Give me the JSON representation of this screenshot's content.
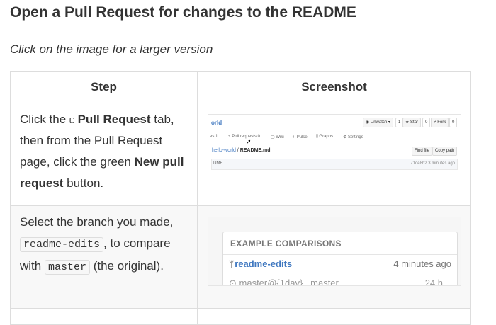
{
  "heading": "Open a Pull Request for changes to the README",
  "subtitle": "Click on the image for a larger version",
  "table": {
    "headers": [
      "Step",
      "Screenshot"
    ],
    "row1": {
      "text_a": "Click the ",
      "icon": "ᥴ",
      "bold_a": "Pull Request",
      "text_b": " tab, then from the Pull Request page, click the green ",
      "bold_b": "New pull request",
      "text_c": " button."
    },
    "row2": {
      "text_a": "Select the branch you made, ",
      "code_a": "readme-edits",
      "text_b": ", to compare with ",
      "code_b": "master",
      "text_c": " (the original)."
    }
  },
  "shot1": {
    "repo": "orld",
    "unwatch": "◉ Unwatch ▾",
    "unwatch_count": "1",
    "star": "★ Star",
    "star_count": "0",
    "fork": "⑂ Fork",
    "fork_count": "0",
    "nav": [
      "es  1",
      "⑂ Pull requests  0",
      "▢ Wiki",
      "∻ Pulse",
      "⫼ Graphs",
      "⚙ Settings"
    ],
    "crumb_link": "hello-world",
    "crumb_sep": " / ",
    "crumb_file": "README.md",
    "find_file": "Find file",
    "copy_path": "Copy path",
    "file_left": "DME",
    "file_right": "71de8b2  3 minutes ago"
  },
  "shot2": {
    "header": "EXAMPLE COMPARISONS",
    "branch": "readme-edits",
    "time": "4 minutes ago",
    "faded_left": "⊙ master@{1day}...master",
    "faded_right": "24 h"
  }
}
